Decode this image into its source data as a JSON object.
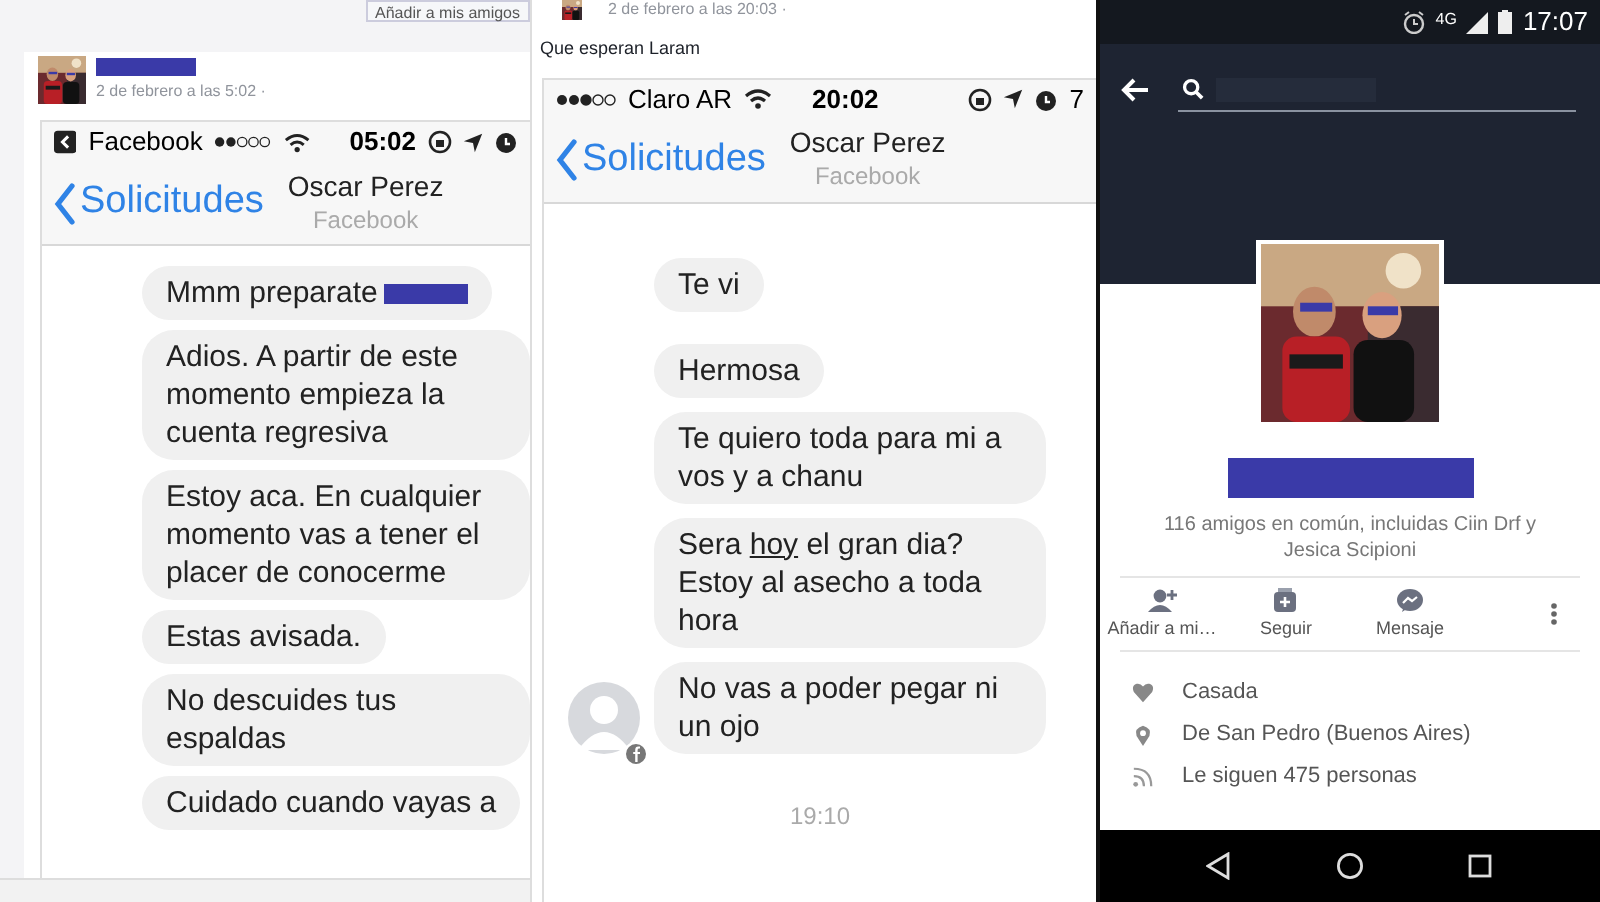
{
  "left_post": {
    "add_friend_button": "Añadir a mis amigos",
    "date": "2 de febrero a las 5:02 ·",
    "status_bar": {
      "app": "Facebook",
      "time": "05:02"
    },
    "nav": {
      "back": "Solicitudes",
      "title": "Oscar Perez",
      "subtitle": "Facebook"
    },
    "messages": [
      {
        "kind": "redacted",
        "text": "Mmm preparate"
      },
      {
        "kind": "text",
        "text": "Adios. A partir de este momento empieza la cuenta regresiva"
      },
      {
        "kind": "text",
        "text": "Estoy aca. En cualquier momento vas a tener el placer de conocerme"
      },
      {
        "kind": "text",
        "text": "Estas avisada."
      },
      {
        "kind": "text",
        "text": "No descuides tus espaldas"
      },
      {
        "kind": "text",
        "text": "Cuidado cuando vayas a"
      }
    ]
  },
  "middle_post": {
    "date": "2 de febrero a las 20:03 ·",
    "caption": "Que esperan Laram",
    "status_bar": {
      "carrier": "Claro AR",
      "time": "20:02",
      "battery": "7"
    },
    "nav": {
      "back": "Solicitudes",
      "title": "Oscar Perez",
      "subtitle": "Facebook"
    },
    "messages": [
      {
        "kind": "text",
        "text": "Te vi",
        "show_avatar": false
      },
      {
        "kind": "text",
        "text": "Hermosa",
        "show_avatar": false
      },
      {
        "kind": "text",
        "text": "Te quiero toda para mi a vos y a chanu",
        "show_avatar": false
      },
      {
        "kind": "underlined",
        "before": "Sera ",
        "underlined": "hoy",
        "after": " el gran dia? Estoy al asecho a toda hora",
        "show_avatar": false
      },
      {
        "kind": "text",
        "text": "No vas a poder pegar ni un ojo",
        "show_avatar": true
      }
    ],
    "time_divider": "19:10"
  },
  "profile": {
    "status_bar": {
      "network": "4G",
      "time": "17:07"
    },
    "mutual_friends": "116 amigos en común, incluidas Ciin Drf y Jesica Scipioni",
    "actions": [
      {
        "kind": "add_friend",
        "label": "Añadir a mi…"
      },
      {
        "kind": "follow",
        "label": "Seguir"
      },
      {
        "kind": "message",
        "label": "Mensaje"
      }
    ],
    "details": [
      {
        "kind": "heart",
        "text": "Casada"
      },
      {
        "kind": "pin",
        "text": "De San Pedro (Buenos Aires)"
      },
      {
        "kind": "feed",
        "text": "Le siguen 475 personas"
      }
    ]
  }
}
